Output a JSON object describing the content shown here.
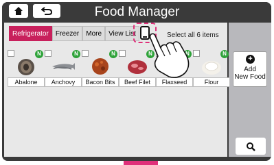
{
  "header": {
    "title": "Food Manager"
  },
  "tabs": [
    {
      "label": "Refrigerator"
    },
    {
      "label": "Freezer"
    },
    {
      "label": "More"
    },
    {
      "label": "View List"
    }
  ],
  "select_all_label": "Select all 6 items",
  "items": [
    {
      "label": "Abalone",
      "badge": "N"
    },
    {
      "label": "Anchovy",
      "badge": "N"
    },
    {
      "label": "Bacon Bits",
      "badge": "N"
    },
    {
      "label": "Beef Filet",
      "badge": "N"
    },
    {
      "label": "Flaxseed",
      "badge": "N"
    },
    {
      "label": "Flour",
      "badge": "N"
    }
  ],
  "side": {
    "add_line1": "Add",
    "add_line2": "New Food"
  },
  "colors": {
    "accent": "#c8205c",
    "badge": "#2fa33a",
    "highlight": "#e0307a"
  }
}
